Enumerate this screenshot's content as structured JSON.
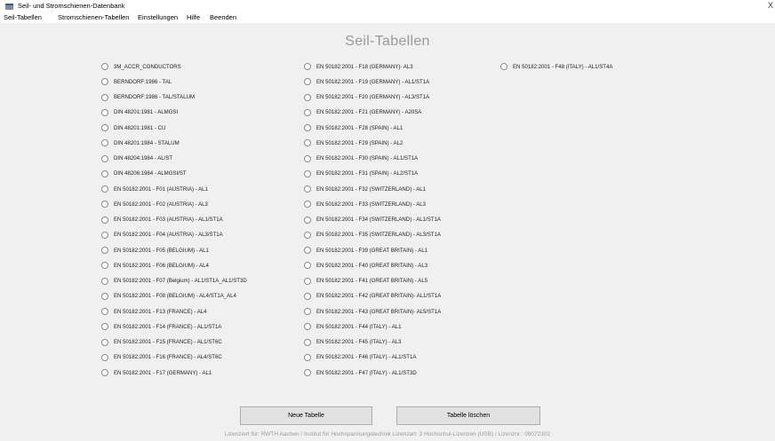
{
  "window": {
    "title": "Seil- und Stromschienen-Datenbank",
    "close_glyph": "X"
  },
  "menu": [
    "Seil-Tabellen",
    "Stromschienen-Tabellen",
    "Einstellungen",
    "Hilfe",
    "Beenden"
  ],
  "heading": "Seil-Tabellen",
  "columns": [
    [
      "3M_ACCR_CONDUCTORS",
      "BERNDORF:1986 - TAL",
      "BERNDORF:1986 - TAL/STALUM",
      "DIN 48201:1981 - ALMGSI",
      "DIN 48201:1981 - CU",
      "DIN 48201:1984 - STALUM",
      "DIN 48204:1984 - AL/ST",
      "DIN 48206:1984 - ALMGSI/ST",
      "EN 50182:2001 - F01 (AUSTRIA) - AL1",
      "EN 50182:2001 - F02 (AUSTRIA) - AL3",
      "EN 50182:2001 - F03 (AUSTRIA) - AL1/ST1A",
      "EN 50182:2001 - F04 (AUSTRIA) - AL3/ST1A",
      "EN 50182:2001 - F05 (BELGIUM) - AL1",
      "EN 50182:2001 - F06 (BELGIUM) - AL4",
      "EN 50182:2001 - F07 (Belgium) - AL1/ST1A_AL1/ST3D",
      "EN 50182:2001 - F08 (BELGIUM) - AL4/ST1A_AL4",
      "EN 50182:2001 - F13 (FRANCE) - AL4",
      "EN 50182:2001 - F14 (FRANCE) - AL1/ST1A",
      "EN 50182:2001 - F15 (FRANCE) - AL1/ST6C",
      "EN 50182:2001 - F16 (FRANCE) - AL4/ST6C",
      "EN 50182:2001 - F17 (GERMANY) - AL1"
    ],
    [
      "EN 50182:2001 - F18 (GERMANY)- AL3",
      "EN 50182:2001 - F19 (GERMANY) - AL1/ST1A",
      "EN 50182:2001 - F20 (GERMANY) - AL3/ST1A",
      "EN 50182:2001 - F21 (GERMANY) - A20SA",
      "EN 50182:2001 - F28 (SPAIN) - AL1",
      "EN 50182:2001 - F29 (SPAIN) - AL2",
      "EN 50182:2001 - F30 (SPAIN) - AL1/ST1A",
      "EN 50182:2001 - F31 (SPAIN) - AL2/ST1A",
      "EN 50182:2001 - F32 (SWITZERLAND) - AL1",
      "EN 50182:2001 - F33 (SWITZERLAND) - AL3",
      "EN 50182:2001 - F34 (SWITZERLAND) - AL1/ST1A",
      "EN 50182:2001 - F35 (SWITZERLAND) - AL3/ST1A",
      "EN 50182:2001 - F39 (GREAT BRITAIN) - AL1",
      "EN 50182:2001 - F40 (GREAT BRITAIN) - AL3",
      "EN 50182:2001 - F41 (GREAT BRITAIN) - AL5",
      "EN 50182:2001 - F42 (GREAT BRITAIN)- AL1/ST1A",
      "EN 50182:2001 - F43 (GREAT BRITAIN)- AL5/ST1A",
      "EN 50182:2001 - F44 (ITALY) - AL1",
      "EN 50182:2001 - F45 (ITALY) - AL3",
      "EN 50182:2001 - F46 (ITALY) - AL1/ST1A",
      "EN 50182:2001 - F47 (ITALY) - AL1/ST3D"
    ],
    [
      "EN 50182:2001 - F48 (ITALY) - AL1/ST4A"
    ]
  ],
  "buttons": {
    "new_table": "Neue Tabelle",
    "delete_table": "Tabelle löschen"
  },
  "license": "Lizenziert für: RWTH Aachen / Institut für Hochspannungstechnik  Lizenzart:  2 Hochschul-Lizenzen (USB) / Lizenznr.: 09072302"
}
